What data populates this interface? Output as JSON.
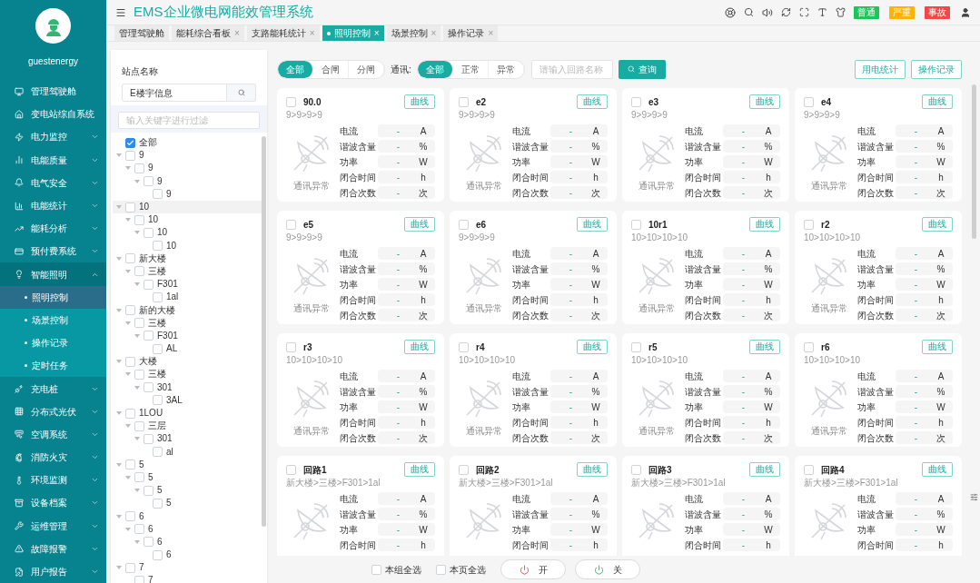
{
  "app": {
    "title": "EMS企业微电网能效管理系统",
    "username": "guestenergy"
  },
  "alarm_badges": [
    {
      "label": "普通",
      "color": "#1ec45a"
    },
    {
      "label": "严重",
      "color": "#ffb300"
    },
    {
      "label": "事故",
      "color": "#f04848"
    }
  ],
  "sidebar": {
    "items": [
      {
        "label": "管理驾驶舱",
        "expandable": false
      },
      {
        "label": "变电站综自系统",
        "expandable": true,
        "expanded": false
      },
      {
        "label": "电力监控",
        "expandable": true,
        "expanded": false
      },
      {
        "label": "电能质量",
        "expandable": true,
        "expanded": false
      },
      {
        "label": "电气安全",
        "expandable": true,
        "expanded": false
      },
      {
        "label": "电能统计",
        "expandable": true,
        "expanded": false
      },
      {
        "label": "能耗分析",
        "expandable": true,
        "expanded": false
      },
      {
        "label": "预付费系统",
        "expandable": true,
        "expanded": false
      },
      {
        "label": "智能照明",
        "expandable": true,
        "expanded": true,
        "children": [
          {
            "label": "照明控制",
            "selected": true
          },
          {
            "label": "场景控制",
            "selected": false
          },
          {
            "label": "操作记录",
            "selected": false
          },
          {
            "label": "定时任务",
            "selected": false
          }
        ]
      },
      {
        "label": "充电桩",
        "expandable": true,
        "expanded": false
      },
      {
        "label": "分布式光伏",
        "expandable": true,
        "expanded": false
      },
      {
        "label": "空调系统",
        "expandable": true,
        "expanded": false
      },
      {
        "label": "消防火灾",
        "expandable": true,
        "expanded": false
      },
      {
        "label": "环境监测",
        "expandable": true,
        "expanded": false
      },
      {
        "label": "设备档案",
        "expandable": true,
        "expanded": false
      },
      {
        "label": "运维管理",
        "expandable": true,
        "expanded": false
      },
      {
        "label": "故障报警",
        "expandable": true,
        "expanded": false
      },
      {
        "label": "用户报告",
        "expandable": true,
        "expanded": false
      }
    ]
  },
  "tabs": [
    {
      "label": "管理驾驶舱",
      "selected": false
    },
    {
      "label": "能耗综合看板",
      "selected": false,
      "close": "×"
    },
    {
      "label": "支路能耗统计",
      "selected": false,
      "close": "×"
    },
    {
      "label": "照明控制",
      "selected": true,
      "close": "×"
    },
    {
      "label": "场景控制",
      "selected": false,
      "close": "×"
    },
    {
      "label": "操作记录",
      "selected": false,
      "close": "×"
    }
  ],
  "site_panel": {
    "label": "站点名称",
    "value": "E楼宇信息",
    "filter_placeholder": "输入关键字进行过滤",
    "tree": [
      {
        "label": "全部",
        "checked": true
      },
      {
        "label": "9",
        "checked": false,
        "children": [
          {
            "label": "9",
            "checked": false,
            "children": [
              {
                "label": "9",
                "checked": false,
                "children": [
                  {
                    "label": "9",
                    "checked": false
                  }
                ]
              }
            ]
          }
        ]
      },
      {
        "label": "10",
        "checked": false,
        "children": [
          {
            "label": "10",
            "checked": false,
            "children": [
              {
                "label": "10",
                "checked": false,
                "children": [
                  {
                    "label": "10",
                    "checked": false
                  }
                ]
              }
            ]
          }
        ]
      },
      {
        "label": "新大楼",
        "checked": false,
        "children": [
          {
            "label": "三楼",
            "checked": false,
            "children": [
              {
                "label": "F301",
                "checked": false,
                "children": [
                  {
                    "label": "1al",
                    "checked": false
                  }
                ]
              }
            ]
          }
        ]
      },
      {
        "label": "新的大楼",
        "checked": false,
        "children": [
          {
            "label": "三楼",
            "checked": false,
            "children": [
              {
                "label": "F301",
                "checked": false,
                "children": [
                  {
                    "label": "AL",
                    "checked": false
                  }
                ]
              }
            ]
          }
        ]
      },
      {
        "label": "大楼",
        "checked": false,
        "children": [
          {
            "label": "三楼",
            "checked": false,
            "children": [
              {
                "label": "301",
                "checked": false,
                "children": [
                  {
                    "label": "3AL",
                    "checked": false
                  }
                ]
              }
            ]
          }
        ]
      },
      {
        "label": "1LOU",
        "checked": false,
        "children": [
          {
            "label": "三层",
            "checked": false,
            "children": [
              {
                "label": "301",
                "checked": false,
                "children": [
                  {
                    "label": "al",
                    "checked": false
                  }
                ]
              }
            ]
          }
        ]
      },
      {
        "label": "5",
        "checked": false,
        "children": [
          {
            "label": "5",
            "checked": false,
            "children": [
              {
                "label": "5",
                "checked": false,
                "children": [
                  {
                    "label": "5",
                    "checked": false
                  }
                ]
              }
            ]
          }
        ]
      },
      {
        "label": "6",
        "checked": false,
        "children": [
          {
            "label": "6",
            "checked": false,
            "children": [
              {
                "label": "6",
                "checked": false,
                "children": [
                  {
                    "label": "6",
                    "checked": false
                  }
                ]
              }
            ]
          }
        ]
      },
      {
        "label": "7",
        "checked": false,
        "children": [
          {
            "label": "7",
            "checked": false
          }
        ]
      }
    ]
  },
  "filters": {
    "switch_options": [
      {
        "label": "全部",
        "selected": true
      },
      {
        "label": "合闸",
        "selected": false
      },
      {
        "label": "分闸",
        "selected": false
      }
    ],
    "comm_label": "通讯:",
    "comm_options": [
      {
        "label": "全部",
        "selected": true
      },
      {
        "label": "正常",
        "selected": false
      },
      {
        "label": "异常",
        "selected": false
      }
    ],
    "search_placeholder": "请输入回路名称",
    "search_button": "查询",
    "right_buttons": [
      "用电统计",
      "操作记录"
    ]
  },
  "cards": [
    {
      "name": "90.0",
      "path": "9>9>9>9",
      "checked": false,
      "button": "曲线",
      "status": "通讯异常",
      "metrics": [
        {
          "label": "电流",
          "value": "-",
          "unit": "A"
        },
        {
          "label": "谐波含量",
          "value": "-",
          "unit": "%"
        },
        {
          "label": "功率",
          "value": "-",
          "unit": "W"
        },
        {
          "label": "闭合时间",
          "value": "-",
          "unit": "h"
        },
        {
          "label": "闭合次数",
          "value": "-",
          "unit": "次"
        }
      ]
    },
    {
      "name": "e2",
      "path": "9>9>9>9",
      "checked": false,
      "button": "曲线",
      "status": "通讯异常",
      "metrics": [
        {
          "label": "电流",
          "value": "-",
          "unit": "A"
        },
        {
          "label": "谐波含量",
          "value": "-",
          "unit": "%"
        },
        {
          "label": "功率",
          "value": "-",
          "unit": "W"
        },
        {
          "label": "闭合时间",
          "value": "-",
          "unit": "h"
        },
        {
          "label": "闭合次数",
          "value": "-",
          "unit": "次"
        }
      ]
    },
    {
      "name": "e3",
      "path": "9>9>9>9",
      "checked": false,
      "button": "曲线",
      "status": "通讯异常",
      "metrics": [
        {
          "label": "电流",
          "value": "-",
          "unit": "A"
        },
        {
          "label": "谐波含量",
          "value": "-",
          "unit": "%"
        },
        {
          "label": "功率",
          "value": "-",
          "unit": "W"
        },
        {
          "label": "闭合时间",
          "value": "-",
          "unit": "h"
        },
        {
          "label": "闭合次数",
          "value": "-",
          "unit": "次"
        }
      ]
    },
    {
      "name": "e4",
      "path": "9>9>9>9",
      "checked": false,
      "button": "曲线",
      "status": "通讯异常",
      "metrics": [
        {
          "label": "电流",
          "value": "-",
          "unit": "A"
        },
        {
          "label": "谐波含量",
          "value": "-",
          "unit": "%"
        },
        {
          "label": "功率",
          "value": "-",
          "unit": "W"
        },
        {
          "label": "闭合时间",
          "value": "-",
          "unit": "h"
        },
        {
          "label": "闭合次数",
          "value": "-",
          "unit": "次"
        }
      ]
    },
    {
      "name": "e5",
      "path": "9>9>9>9",
      "checked": false,
      "button": "曲线",
      "status": "通讯异常",
      "metrics": [
        {
          "label": "电流",
          "value": "-",
          "unit": "A"
        },
        {
          "label": "谐波含量",
          "value": "-",
          "unit": "%"
        },
        {
          "label": "功率",
          "value": "-",
          "unit": "W"
        },
        {
          "label": "闭合时间",
          "value": "-",
          "unit": "h"
        },
        {
          "label": "闭合次数",
          "value": "-",
          "unit": "次"
        }
      ]
    },
    {
      "name": "e6",
      "path": "9>9>9>9",
      "checked": false,
      "button": "曲线",
      "status": "通讯异常",
      "metrics": [
        {
          "label": "电流",
          "value": "-",
          "unit": "A"
        },
        {
          "label": "谐波含量",
          "value": "-",
          "unit": "%"
        },
        {
          "label": "功率",
          "value": "-",
          "unit": "W"
        },
        {
          "label": "闭合时间",
          "value": "-",
          "unit": "h"
        },
        {
          "label": "闭合次数",
          "value": "-",
          "unit": "次"
        }
      ]
    },
    {
      "name": "10r1",
      "path": "10>10>10>10",
      "checked": false,
      "button": "曲线",
      "status": "通讯异常",
      "metrics": [
        {
          "label": "电流",
          "value": "-",
          "unit": "A"
        },
        {
          "label": "谐波含量",
          "value": "-",
          "unit": "%"
        },
        {
          "label": "功率",
          "value": "-",
          "unit": "W"
        },
        {
          "label": "闭合时间",
          "value": "-",
          "unit": "h"
        },
        {
          "label": "闭合次数",
          "value": "-",
          "unit": "次"
        }
      ]
    },
    {
      "name": "r2",
      "path": "10>10>10>10",
      "checked": false,
      "button": "曲线",
      "status": "通讯异常",
      "metrics": [
        {
          "label": "电流",
          "value": "-",
          "unit": "A"
        },
        {
          "label": "谐波含量",
          "value": "-",
          "unit": "%"
        },
        {
          "label": "功率",
          "value": "-",
          "unit": "W"
        },
        {
          "label": "闭合时间",
          "value": "-",
          "unit": "h"
        },
        {
          "label": "闭合次数",
          "value": "-",
          "unit": "次"
        }
      ]
    },
    {
      "name": "r3",
      "path": "10>10>10>10",
      "checked": false,
      "button": "曲线",
      "status": "通讯异常",
      "metrics": [
        {
          "label": "电流",
          "value": "-",
          "unit": "A"
        },
        {
          "label": "谐波含量",
          "value": "-",
          "unit": "%"
        },
        {
          "label": "功率",
          "value": "-",
          "unit": "W"
        },
        {
          "label": "闭合时间",
          "value": "-",
          "unit": "h"
        },
        {
          "label": "闭合次数",
          "value": "-",
          "unit": "次"
        }
      ]
    },
    {
      "name": "r4",
      "path": "10>10>10>10",
      "checked": false,
      "button": "曲线",
      "status": "通讯异常",
      "metrics": [
        {
          "label": "电流",
          "value": "-",
          "unit": "A"
        },
        {
          "label": "谐波含量",
          "value": "-",
          "unit": "%"
        },
        {
          "label": "功率",
          "value": "-",
          "unit": "W"
        },
        {
          "label": "闭合时间",
          "value": "-",
          "unit": "h"
        },
        {
          "label": "闭合次数",
          "value": "-",
          "unit": "次"
        }
      ]
    },
    {
      "name": "r5",
      "path": "10>10>10>10",
      "checked": false,
      "button": "曲线",
      "status": "通讯异常",
      "metrics": [
        {
          "label": "电流",
          "value": "-",
          "unit": "A"
        },
        {
          "label": "谐波含量",
          "value": "-",
          "unit": "%"
        },
        {
          "label": "功率",
          "value": "-",
          "unit": "W"
        },
        {
          "label": "闭合时间",
          "value": "-",
          "unit": "h"
        },
        {
          "label": "闭合次数",
          "value": "-",
          "unit": "次"
        }
      ]
    },
    {
      "name": "r6",
      "path": "10>10>10>10",
      "checked": false,
      "button": "曲线",
      "status": "通讯异常",
      "metrics": [
        {
          "label": "电流",
          "value": "-",
          "unit": "A"
        },
        {
          "label": "谐波含量",
          "value": "-",
          "unit": "%"
        },
        {
          "label": "功率",
          "value": "-",
          "unit": "W"
        },
        {
          "label": "闭合时间",
          "value": "-",
          "unit": "h"
        },
        {
          "label": "闭合次数",
          "value": "-",
          "unit": "次"
        }
      ]
    },
    {
      "name": "回路1",
      "path": "新大楼>三楼>F301>1al",
      "checked": false,
      "button": "曲线",
      "metrics": [
        {
          "label": "电流",
          "value": "-",
          "unit": "A"
        },
        {
          "label": "谐波含量",
          "value": "-",
          "unit": "%"
        },
        {
          "label": "功率",
          "value": "-",
          "unit": "W"
        },
        {
          "label": "闭合时间",
          "value": "-",
          "unit": "h"
        }
      ]
    },
    {
      "name": "回路2",
      "path": "新大楼>三楼>F301>1al",
      "checked": false,
      "button": "曲线",
      "metrics": [
        {
          "label": "电流",
          "value": "-",
          "unit": "A"
        },
        {
          "label": "谐波含量",
          "value": "-",
          "unit": "%"
        },
        {
          "label": "功率",
          "value": "-",
          "unit": "W"
        },
        {
          "label": "闭合时间",
          "value": "-",
          "unit": "h"
        }
      ]
    },
    {
      "name": "回路3",
      "path": "新大楼>三楼>F301>1al",
      "checked": false,
      "button": "曲线",
      "metrics": [
        {
          "label": "电流",
          "value": "-",
          "unit": "A"
        },
        {
          "label": "谐波含量",
          "value": "-",
          "unit": "%"
        },
        {
          "label": "功率",
          "value": "-",
          "unit": "W"
        },
        {
          "label": "闭合时间",
          "value": "-",
          "unit": "h"
        }
      ]
    },
    {
      "name": "回路4",
      "path": "新大楼>三楼>F301>1al",
      "checked": false,
      "button": "曲线",
      "metrics": [
        {
          "label": "电流",
          "value": "-",
          "unit": "A"
        },
        {
          "label": "谐波含量",
          "value": "-",
          "unit": "%"
        },
        {
          "label": "功率",
          "value": "-",
          "unit": "W"
        },
        {
          "label": "闭合时间",
          "value": "-",
          "unit": "h"
        }
      ]
    }
  ],
  "footer": {
    "select_group": {
      "label": "本组全选",
      "checked": false
    },
    "select_page": {
      "label": "本页全选",
      "checked": false
    },
    "on_button": "开",
    "off_button": "关"
  }
}
